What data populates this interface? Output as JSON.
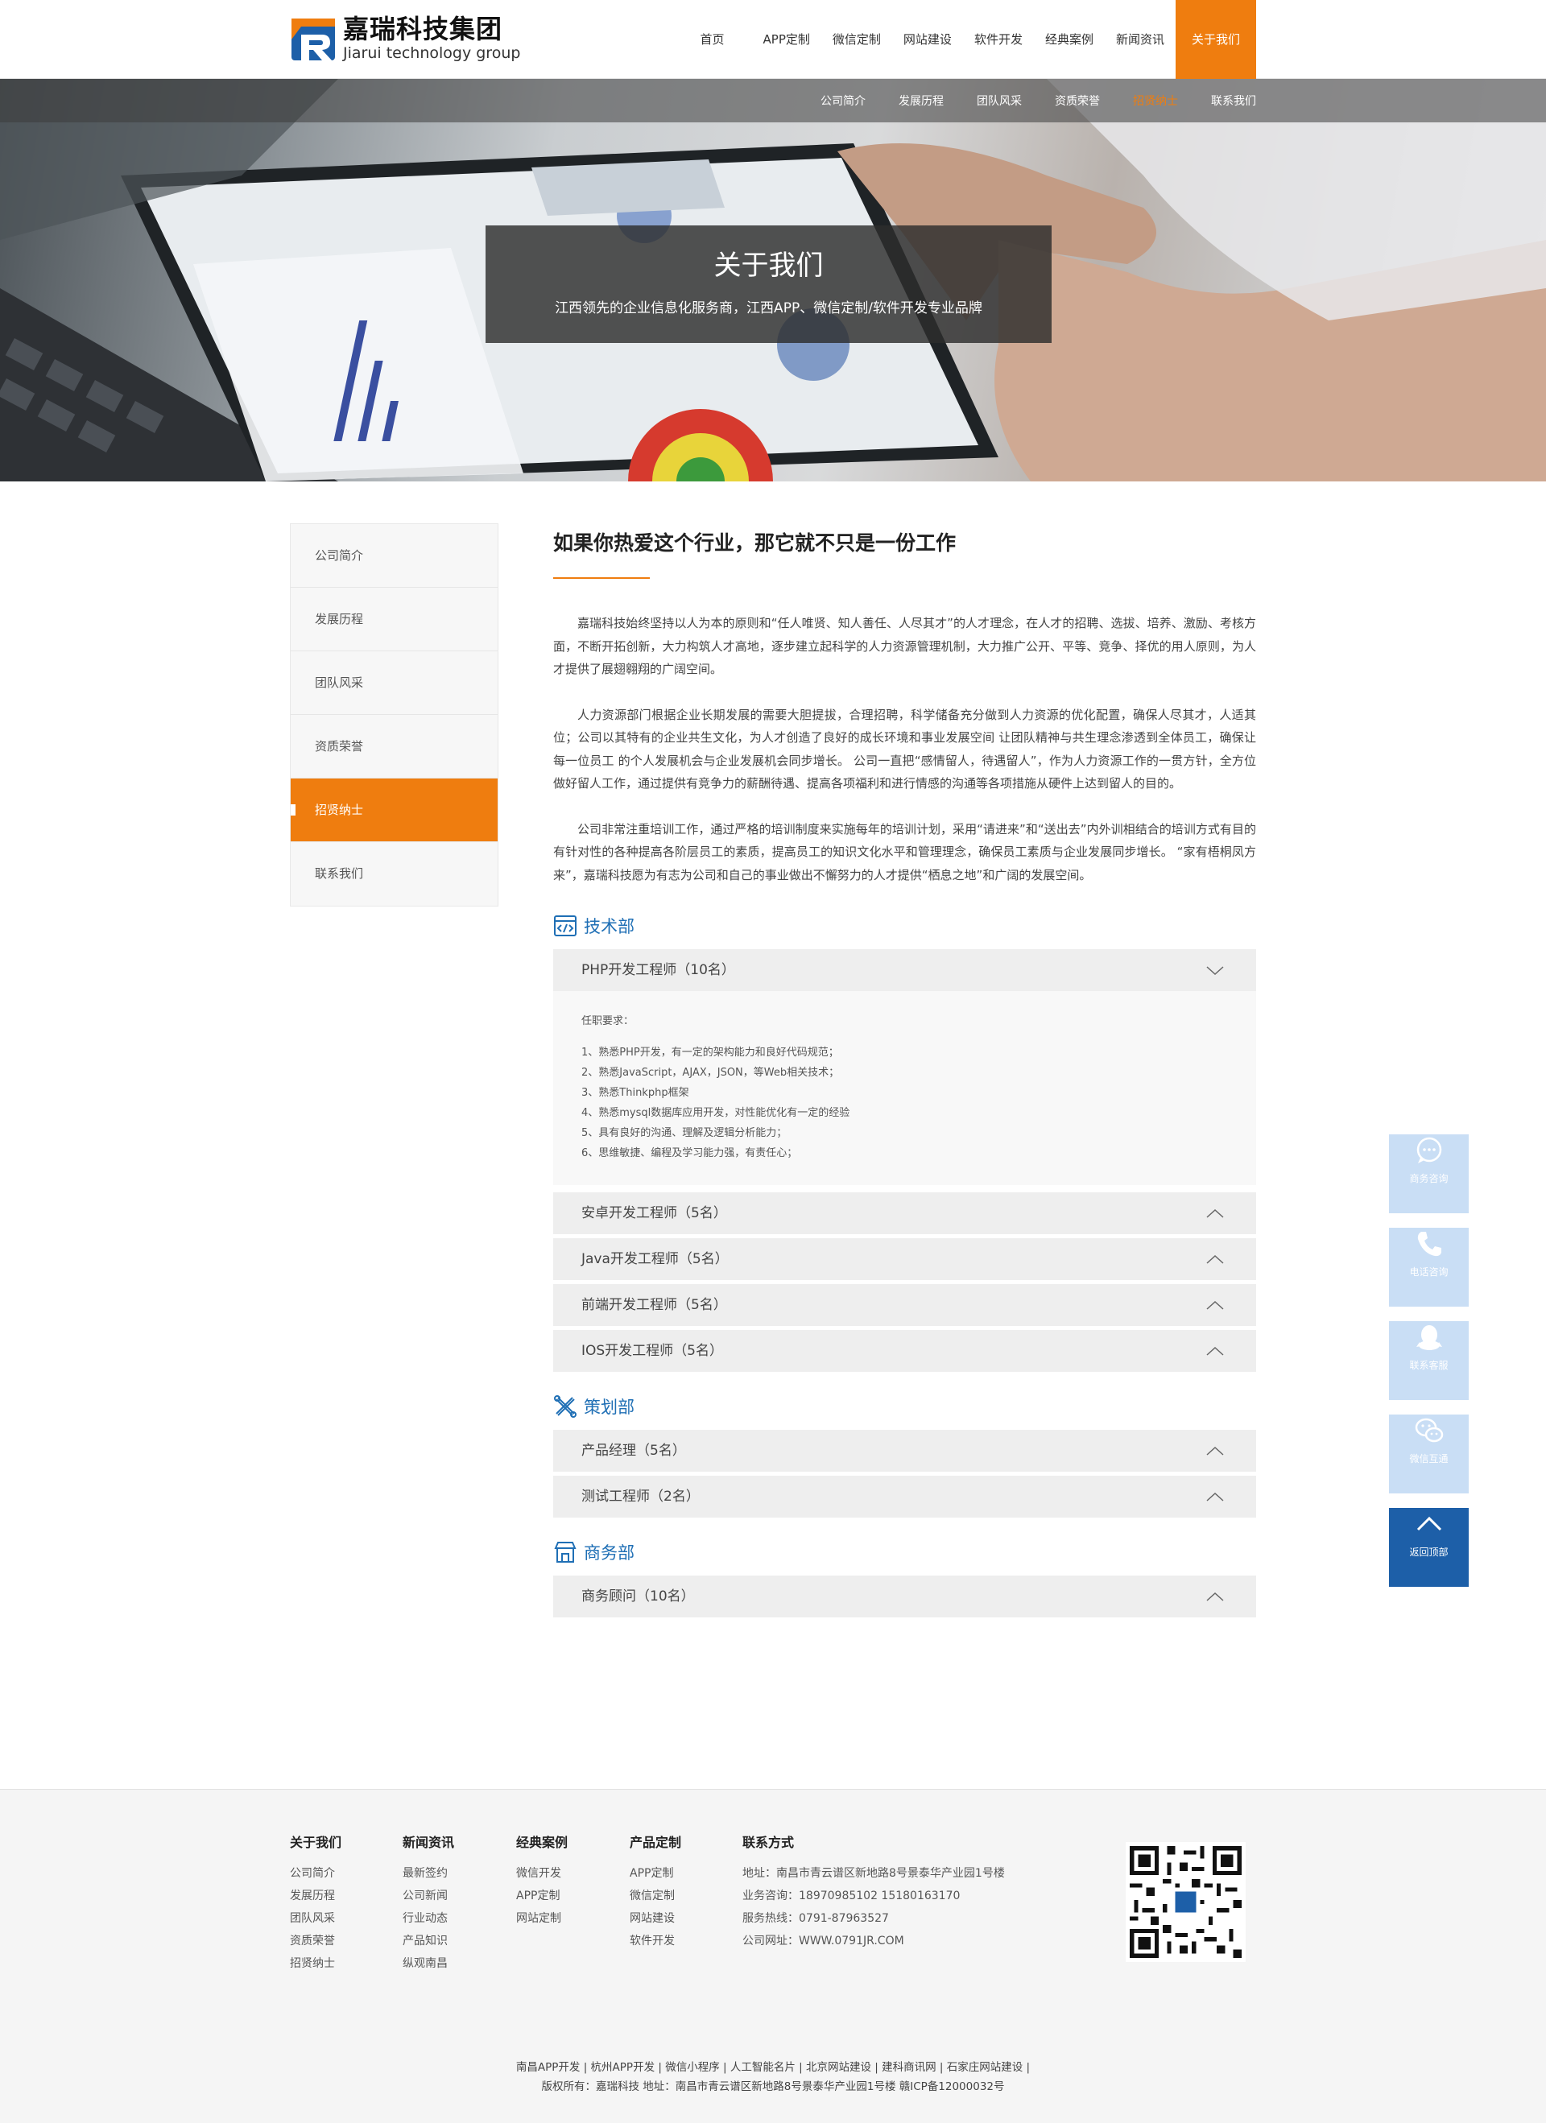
{
  "brand": {
    "name": "嘉瑞科技集团",
    "english": "Jiarui technology group",
    "colors": {
      "accent": "#ef7d0f",
      "primary": "#1f6fb5",
      "logo_blue": "#1d5fa8",
      "logo_orange": "#ef7d0f"
    }
  },
  "nav": {
    "items": [
      "首页",
      "APP定制",
      "微信定制",
      "网站建设",
      "软件开发",
      "经典案例",
      "新闻资讯",
      "关于我们"
    ],
    "active": "关于我们"
  },
  "subnav": {
    "items": [
      "公司简介",
      "发展历程",
      "团队风采",
      "资质荣誉",
      "招贤纳士",
      "联系我们"
    ],
    "active": "招贤纳士"
  },
  "banner": {
    "title": "关于我们",
    "subtitle": "江西领先的企业信息化服务商，江西APP、微信定制/软件开发专业品牌"
  },
  "sidebar": {
    "items": [
      "公司简介",
      "发展历程",
      "团队风采",
      "资质荣誉",
      "招贤纳士",
      "联系我们"
    ],
    "active": "招贤纳士"
  },
  "main": {
    "title": "如果你热爱这个行业，那它就不只是一份工作",
    "paragraphs": [
      "嘉瑞科技始终坚持以人为本的原则和“任人唯贤、知人善任、人尽其才”的人才理念，在人才的招聘、选拔、培养、激励、考核方面，不断开拓创新，大力构筑人才高地，逐步建立起科学的人力资源管理机制，大力推广公开、平等、竞争、择优的用人原则，为人才提供了展翅翱翔的广阔空间。",
      "人力资源部门根据企业长期发展的需要大胆提拔，合理招聘，科学储备充分做到人力资源的优化配置，确保人尽其才，人适其位；公司以其特有的企业共生文化，为人才创造了良好的成长环境和事业发展空间 让团队精神与共生理念渗透到全体员工，确保让每一位员工  的个人发展机会与企业发展机会同步增长。  公司一直把“感情留人，待遇留人”，作为人力资源工作的一贯方针，全方位做好留人工作，通过提供有竞争力的薪酬待遇、提高各项福利和进行情感的沟通等各项措施从硬件上达到留人的目的。",
      "公司非常注重培训工作，通过严格的培训制度来实施每年的培训计划，采用“请进来”和“送出去”内外训相结合的培训方式有目的有针对性的各种提高各阶层员工的素质，提高员工的知识文化水平和管理理念，确保员工素质与企业发展同步增长。  “家有梧桐凤方来”，嘉瑞科技愿为有志为公司和自己的事业做出不懈努力的人才提供“栖息之地”和广阔的发展空间。"
    ]
  },
  "departments": [
    {
      "name": "技术部",
      "icon": "code-window-icon",
      "jobs": [
        {
          "title": "PHP开发工程师（10名）",
          "expanded": true,
          "requirements_title": "任职要求：",
          "requirements": [
            "1、熟悉PHP开发，有一定的架构能力和良好代码规范；",
            "2、熟悉JavaScript，AJAX，JSON，等Web相关技术；",
            "3、熟悉Thinkphp框架",
            "4、熟悉mysql数据库应用开发，对性能优化有一定的经验",
            "5、具有良好的沟通、理解及逻辑分析能力；",
            "6、思维敏捷、编程及学习能力强，有责任心；"
          ]
        },
        {
          "title": "安卓开发工程师（5名）",
          "expanded": false
        },
        {
          "title": "Java开发工程师（5名）",
          "expanded": false
        },
        {
          "title": "前端开发工程师（5名）",
          "expanded": false
        },
        {
          "title": "IOS开发工程师（5名）",
          "expanded": false
        }
      ]
    },
    {
      "name": "策划部",
      "icon": "cross-tools-icon",
      "jobs": [
        {
          "title": "产品经理（5名）",
          "expanded": false
        },
        {
          "title": "测试工程师（2名）",
          "expanded": false
        }
      ]
    },
    {
      "name": "商务部",
      "icon": "storefront-icon",
      "jobs": [
        {
          "title": "商务顾问（10名）",
          "expanded": false
        }
      ]
    }
  ],
  "float_bar": {
    "items": [
      {
        "label": "商务咨询",
        "icon": "chat-bubble-icon"
      },
      {
        "label": "电话咨询",
        "icon": "phone-icon"
      },
      {
        "label": "联系客服",
        "icon": "qq-penguin-icon"
      },
      {
        "label": "微信互通",
        "icon": "wechat-icon"
      },
      {
        "label": "返回顶部",
        "icon": "arrow-up-icon"
      }
    ]
  },
  "footer": {
    "columns": [
      {
        "title": "关于我们",
        "links": [
          "公司简介",
          "发展历程",
          "团队风采",
          "资质荣誉",
          "招贤纳士"
        ]
      },
      {
        "title": "新闻资讯",
        "links": [
          "最新签约",
          "公司新闻",
          "行业动态",
          "产品知识",
          "纵观南昌"
        ]
      },
      {
        "title": "经典案例",
        "links": [
          "微信开发",
          "APP定制",
          "网站定制"
        ]
      },
      {
        "title": "产品定制",
        "links": [
          "APP定制",
          "微信定制",
          "网站建设",
          "软件开发"
        ]
      },
      {
        "title": "联系方式",
        "links": [
          "地址：南昌市青云谱区新地路8号景泰华产业园1号楼",
          "业务咨询：18970985102 15180163170",
          "服务热线：0791-87963527",
          "公司网址：WWW.0791JR.COM"
        ]
      }
    ],
    "links_line": "南昌APP开发 | 杭州APP开发 | 微信小程序 | 人工智能名片 | 北京网站建设 | 建科商讯网 | 石家庄网站建设 |",
    "copyright_line": "版权所有：嘉瑞科技    地址：南昌市青云谱区新地路8号景泰华产业园1号楼    赣ICP备12000032号"
  }
}
